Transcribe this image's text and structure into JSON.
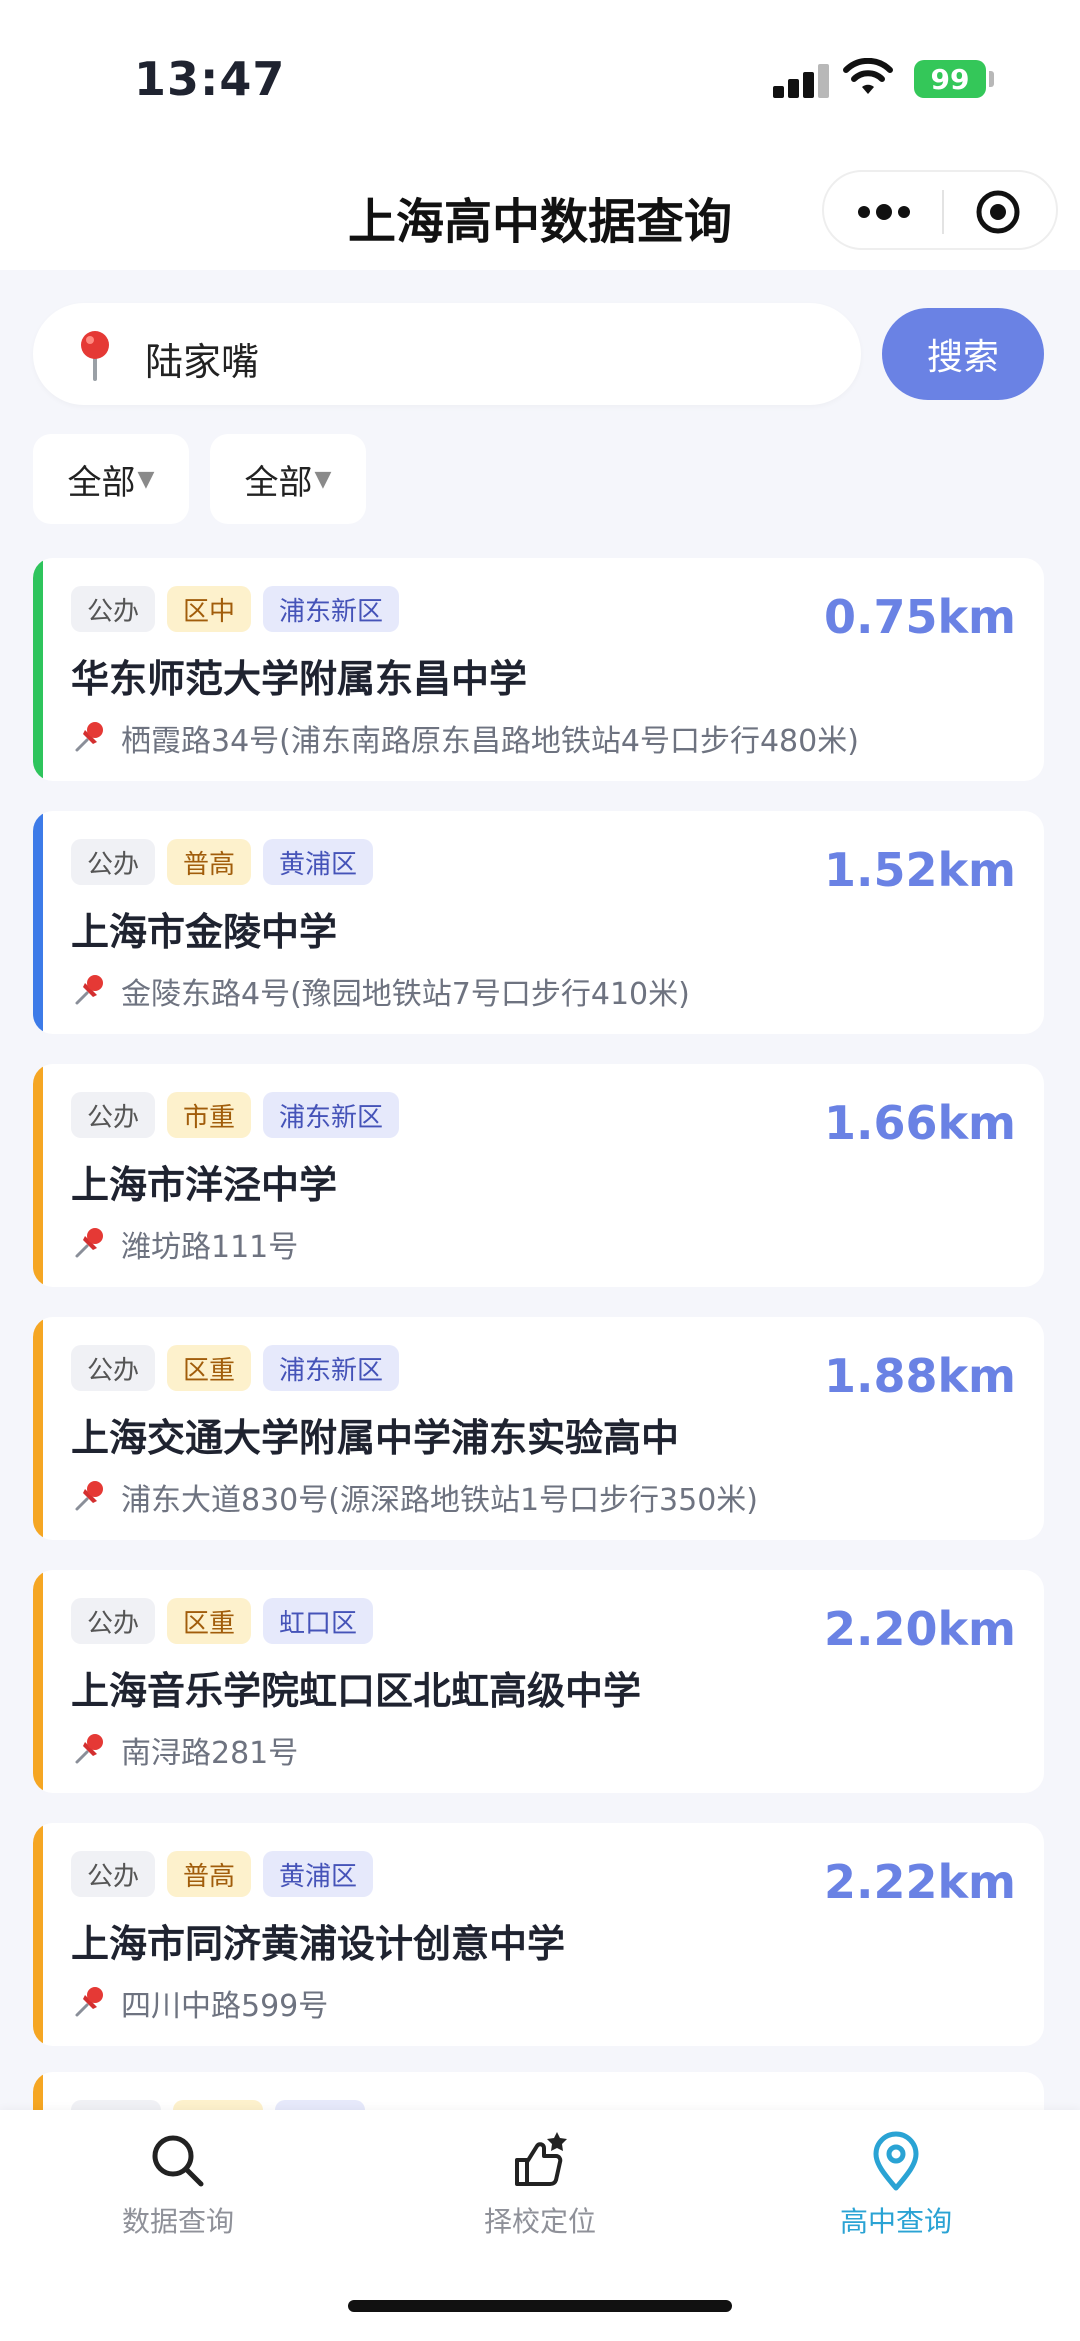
{
  "status": {
    "time": "13:47",
    "battery": "99"
  },
  "header": {
    "title": "上海高中数据查询"
  },
  "search": {
    "value": "陆家嘴",
    "button_label": "搜索"
  },
  "filters": [
    {
      "label": "全部"
    },
    {
      "label": "全部"
    }
  ],
  "colors": {
    "accent": "#6a82e4",
    "green": "#2ec45c",
    "blue": "#3d7be8",
    "orange": "#f5a623",
    "tab_active": "#2aa3d4"
  },
  "schools": [
    {
      "tags": [
        "公办",
        "区中",
        "浦东新区"
      ],
      "name": "华东师范大学附属东昌中学",
      "address": "栖霞路34号(浦东南路原东昌路地铁站4号口步行480米)",
      "distance": "0.75km",
      "stripe": "green"
    },
    {
      "tags": [
        "公办",
        "普高",
        "黄浦区"
      ],
      "name": "上海市金陵中学",
      "address": "金陵东路4号(豫园地铁站7号口步行410米)",
      "distance": "1.52km",
      "stripe": "blue"
    },
    {
      "tags": [
        "公办",
        "市重",
        "浦东新区"
      ],
      "name": "上海市洋泾中学",
      "address": "潍坊路111号",
      "distance": "1.66km",
      "stripe": "orange"
    },
    {
      "tags": [
        "公办",
        "区重",
        "浦东新区"
      ],
      "name": "上海交通大学附属中学浦东实验高中",
      "address": "浦东大道830号(源深路地铁站1号口步行350米)",
      "distance": "1.88km",
      "stripe": "orange"
    },
    {
      "tags": [
        "公办",
        "区重",
        "虹口区"
      ],
      "name": "上海音乐学院虹口区北虹高级中学",
      "address": "南浔路281号",
      "distance": "2.20km",
      "stripe": "orange"
    },
    {
      "tags": [
        "公办",
        "普高",
        "黄浦区"
      ],
      "name": "上海市同济黄浦设计创意中学",
      "address": "四川中路599号",
      "distance": "2.22km",
      "stripe": "orange"
    }
  ],
  "tabbar": {
    "items": [
      {
        "label": "数据查询",
        "icon": "search-icon"
      },
      {
        "label": "择校定位",
        "icon": "thumbs-up-star-icon"
      },
      {
        "label": "高中查询",
        "icon": "location-pin-icon"
      }
    ],
    "active_index": 2
  }
}
